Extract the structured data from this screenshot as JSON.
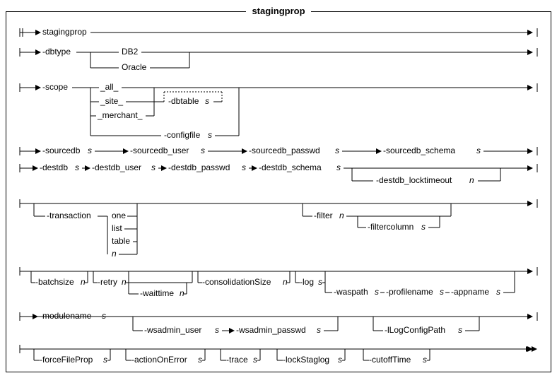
{
  "title": "stagingprop",
  "tokens": {
    "cmd": "stagingprop",
    "dbtype": "-dbtype",
    "db2": "DB2",
    "oracle": "Oracle",
    "scope": "-scope",
    "all": "_all_",
    "site": "_site_",
    "merchant": "_merchant_",
    "dbtable": "-dbtable",
    "configfile": "-configfile",
    "sourcedb": "-sourcedb",
    "sourcedb_user": "-sourcedb_user",
    "sourcedb_passwd": "-sourcedb_passwd",
    "sourcedb_schema": "-sourcedb_schema",
    "destdb": "-destdb",
    "destdb_user": "-destdb_user",
    "destdb_passwd": "-destdb_passwd",
    "destdb_schema": "-destdb_schema",
    "destdb_locktimeout": "-destdb_locktimeout",
    "transaction": "-transaction",
    "one": "one",
    "list": "list",
    "table": "table",
    "filter": "-filter",
    "filtercolumn": "-filtercolumn",
    "batchsize": "-batchsize",
    "retry": "-retry",
    "waittime": "-waittime",
    "consolidationSize": "-consolidationSize",
    "log": "-log",
    "waspath": "-waspath",
    "profilename": "-profilename",
    "appname": "-appname",
    "modulename": "-modulename",
    "wsadmin_user": "-wsadmin_user",
    "wsadmin_passwd": "-wsadmin_passwd",
    "logConfigPath": "-lLogConfigPath",
    "forceFileProp": "-forceFileProp",
    "actionOnError": "-actionOnError",
    "trace": "-trace",
    "lockStaglog": "-lockStaglog",
    "cutoffTime": "-cutoffTime",
    "s": "s",
    "n": "n"
  }
}
